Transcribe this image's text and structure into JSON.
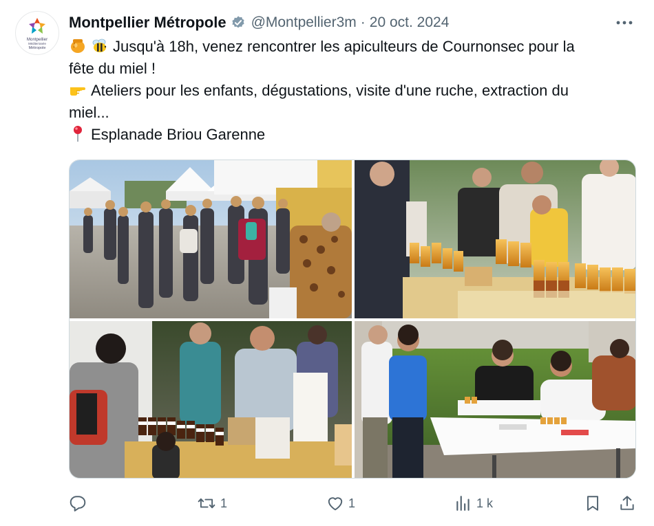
{
  "author": {
    "display_name": "Montpellier Métropole",
    "handle": "@Montpellier3m",
    "separator": "·",
    "date": "20 oct. 2024",
    "verified": true,
    "avatar_logo_text": [
      "Montpellier",
      "Méditerranée",
      "Métropole"
    ]
  },
  "tweet": {
    "lines": [
      {
        "emoji": [
          "honey-pot-icon",
          "bee-icon"
        ],
        "text": "Jusqu'à 18h, venez rencontrer les apiculteurs de Cournonsec pour la"
      },
      {
        "emoji": [],
        "text": "fête du miel !"
      },
      {
        "emoji": [
          "pointing-hand-icon"
        ],
        "text": "Ateliers pour les enfants, dégustations, visite d'une ruche, extraction du"
      },
      {
        "emoji": [],
        "text": "miel..."
      },
      {
        "emoji": [
          "round-pushpin-icon"
        ],
        "text": "Esplanade Briou Garenne"
      }
    ]
  },
  "media": {
    "photo_count": 4,
    "subjects": [
      "market-tents-crowd",
      "honey-jars-stand",
      "honey-tasting-stand",
      "children-at-tables"
    ]
  },
  "actions": {
    "reply": {
      "icon": "reply-icon",
      "count": ""
    },
    "retweet": {
      "icon": "retweet-icon",
      "count": "1"
    },
    "like": {
      "icon": "heart-icon",
      "count": "1"
    },
    "views": {
      "icon": "views-icon",
      "count": "1 k"
    },
    "bookmark": {
      "icon": "bookmark-icon",
      "count": ""
    },
    "share": {
      "icon": "share-icon",
      "count": ""
    }
  },
  "colors": {
    "text_primary": "#0f1419",
    "text_secondary": "#536471",
    "verified_badge": "#829aab",
    "border": "#cfd9de"
  }
}
